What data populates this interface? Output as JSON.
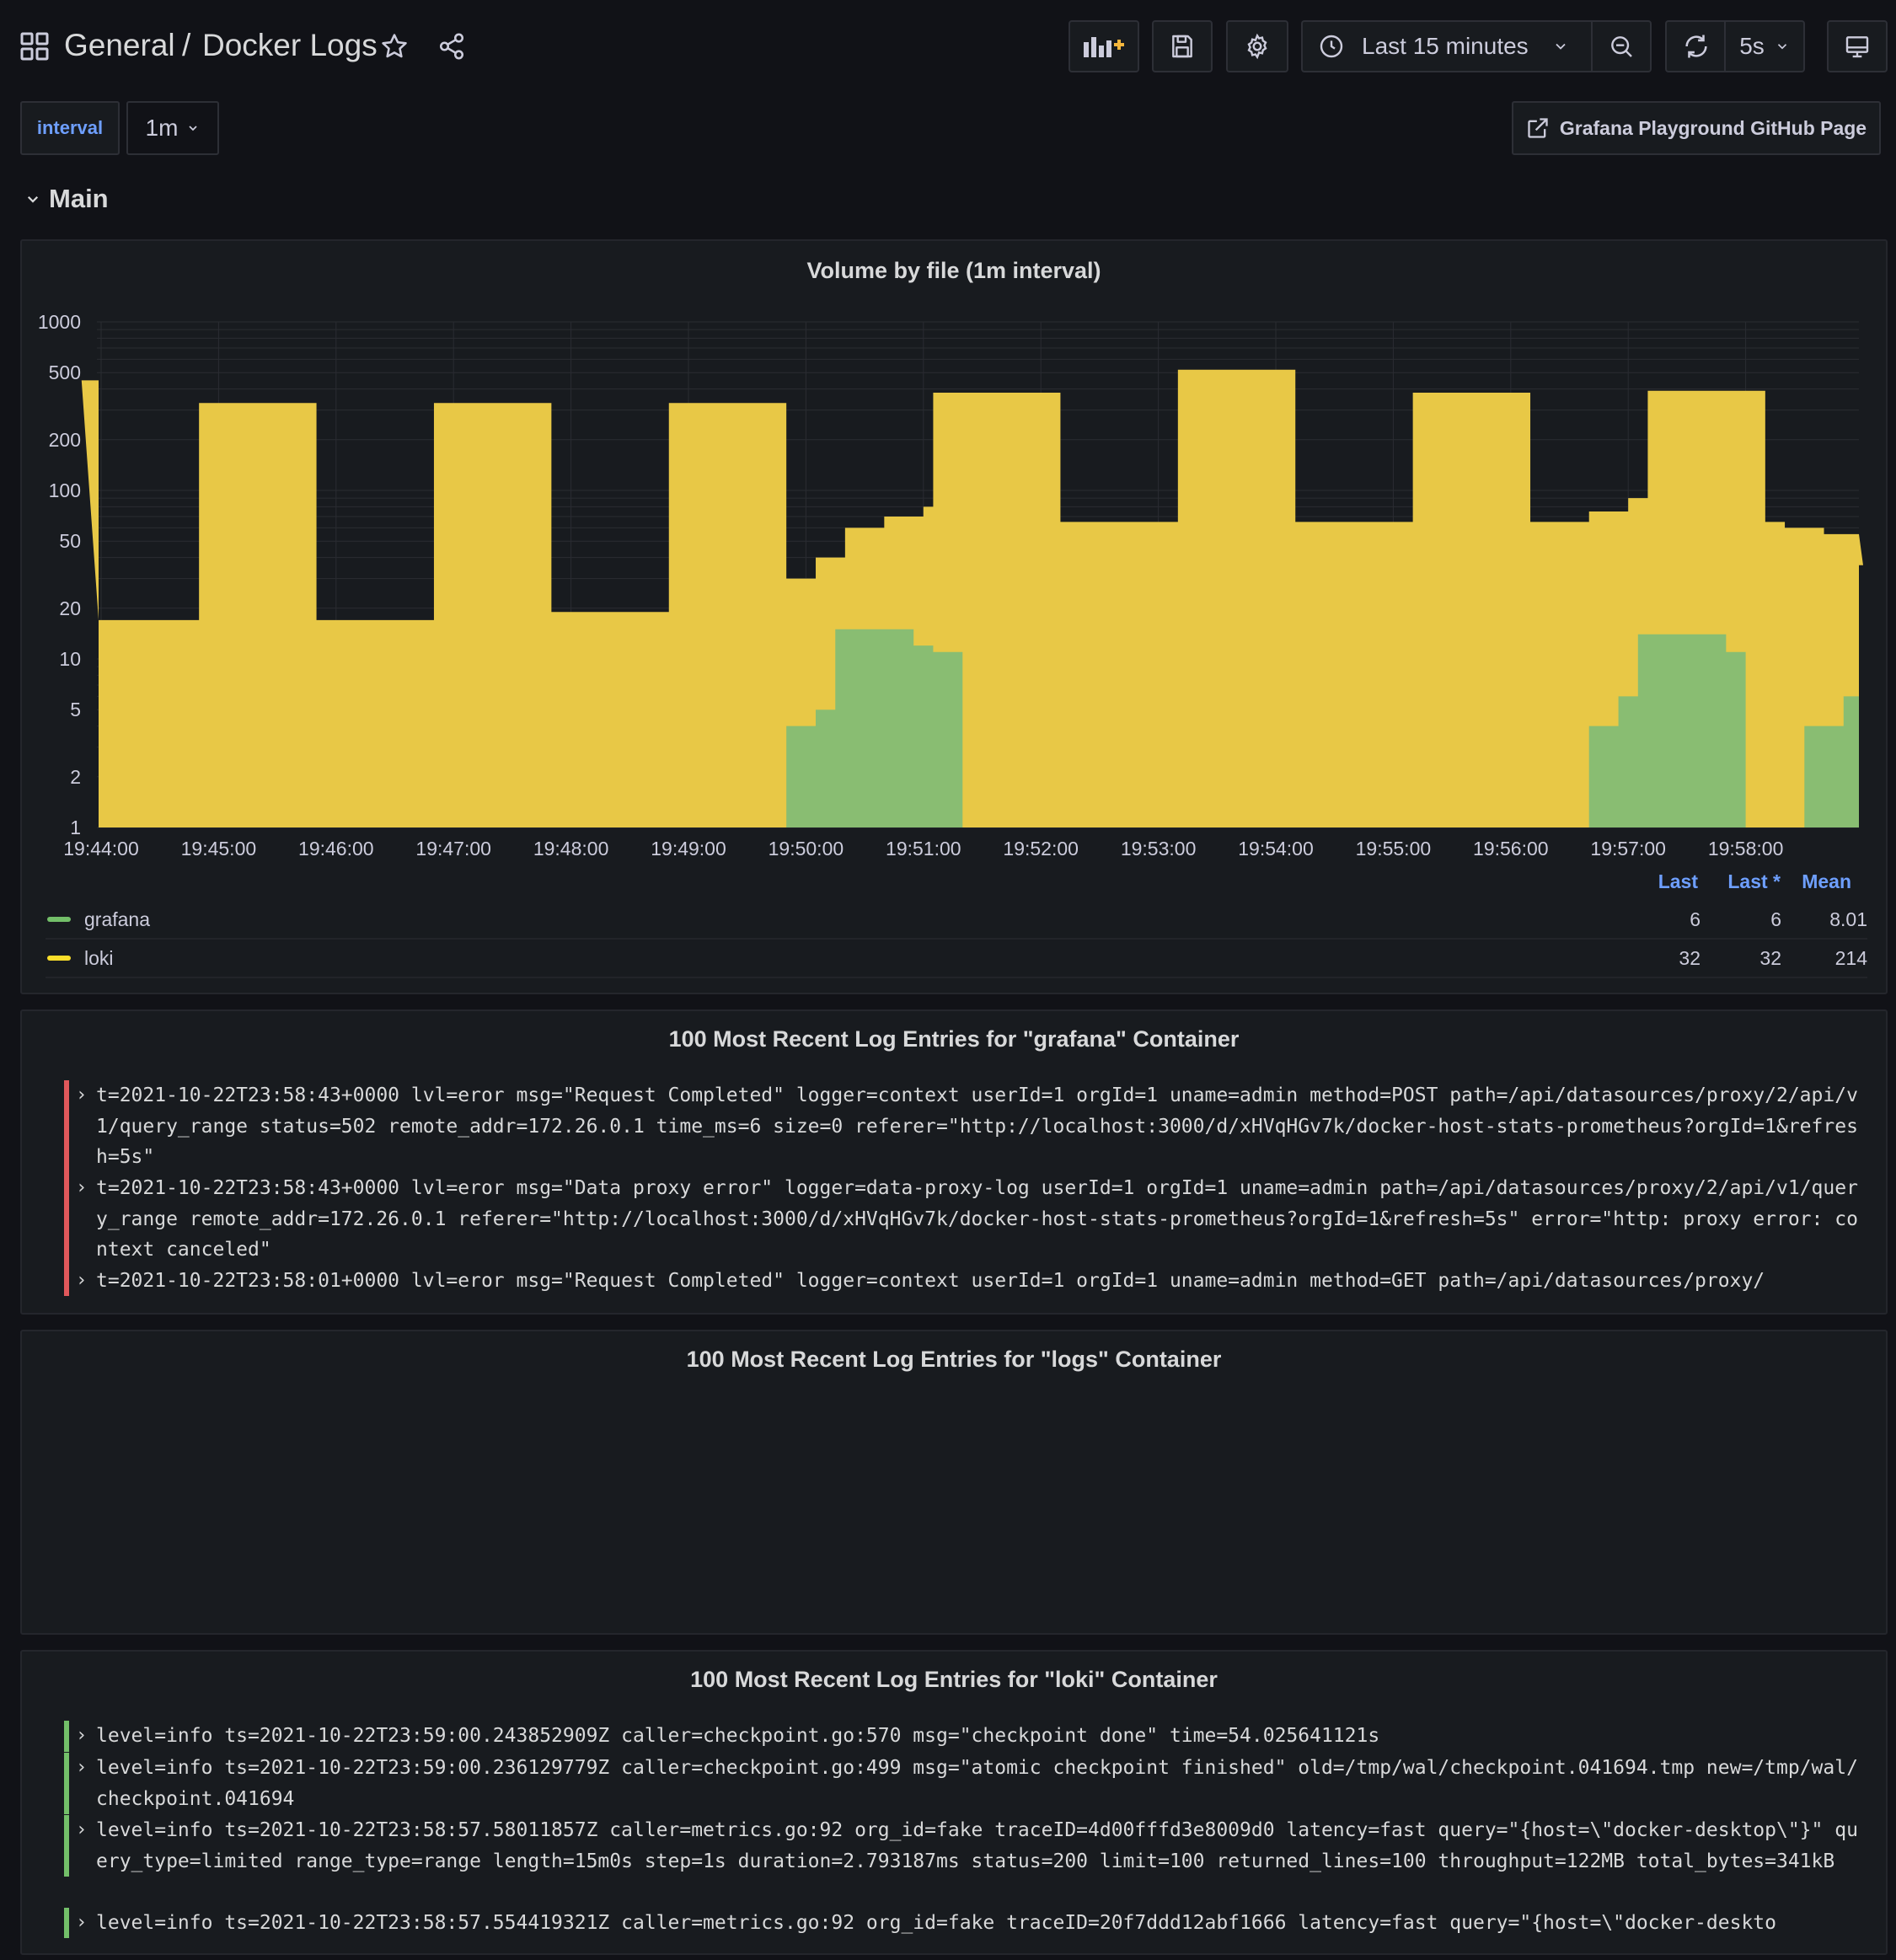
{
  "nav": {
    "breadcrumb_parent": "General",
    "breadcrumb_separator": "/",
    "dashboard_title": "Docker Logs",
    "time_range": "Last 15 minutes",
    "refresh_interval": "5s"
  },
  "variables": {
    "interval_label": "interval",
    "interval_value": "1m",
    "link_label": "Grafana Playground GitHub Page"
  },
  "row": {
    "title": "Main"
  },
  "volume_panel": {
    "title": "Volume by file (1m interval)",
    "legend": {
      "headers": [
        "Last",
        "Last *",
        "Mean"
      ],
      "items": [
        {
          "name": "grafana",
          "color": "#73bf69",
          "last": "6",
          "last_star": "6",
          "mean": "8.01"
        },
        {
          "name": "loki",
          "color": "#fade2a",
          "last": "32",
          "last_star": "32",
          "mean": "214"
        }
      ]
    }
  },
  "chart_data": {
    "type": "area",
    "title": "Volume by file (1m interval)",
    "y_scale": "log",
    "ylim": [
      1,
      1000
    ],
    "y_ticks": [
      "1",
      "2",
      "5",
      "10",
      "20",
      "50",
      "100",
      "200",
      "500",
      "1000"
    ],
    "x_ticks": [
      "19:44:00",
      "19:45:00",
      "19:46:00",
      "19:47:00",
      "19:48:00",
      "19:49:00",
      "19:50:00",
      "19:51:00",
      "19:52:00",
      "19:53:00",
      "19:54:00",
      "19:55:00",
      "19:56:00",
      "19:57:00",
      "19:58:00"
    ],
    "stacked": true,
    "series": [
      {
        "name": "loki",
        "color": "#e8c846",
        "x": [
          "19:43:40",
          "19:43:50",
          "19:44:50",
          "19:45:50",
          "19:46:50",
          "19:47:50",
          "19:48:50",
          "19:49:50",
          "19:50:05",
          "19:50:20",
          "19:50:40",
          "19:51:00",
          "19:51:05",
          "19:52:10",
          "19:53:10",
          "19:54:10",
          "19:55:10",
          "19:56:10",
          "19:56:40",
          "19:57:00",
          "19:57:10",
          "19:58:10",
          "19:58:20",
          "19:58:40",
          "19:59:00"
        ],
        "values": [
          450,
          17,
          330,
          17,
          330,
          19,
          330,
          30,
          40,
          60,
          70,
          80,
          380,
          65,
          520,
          65,
          380,
          65,
          75,
          90,
          390,
          65,
          60,
          55,
          36
        ]
      },
      {
        "name": "grafana",
        "color": "#89bd72",
        "x": [
          "19:49:50",
          "19:50:05",
          "19:50:15",
          "19:50:25",
          "19:50:55",
          "19:51:05",
          "19:51:20",
          "19:51:25",
          "19:56:40",
          "19:56:55",
          "19:57:05",
          "19:57:50",
          "19:58:00",
          "19:58:30",
          "19:58:50"
        ],
        "values": [
          4,
          5,
          15,
          15,
          12,
          11,
          0,
          0,
          4,
          6,
          14,
          11,
          0,
          4,
          6
        ]
      }
    ],
    "legend": [
      "grafana",
      "loki"
    ]
  },
  "grafana_logs": {
    "title": "100 Most Recent Log Entries for \"grafana\" Container",
    "level_color": "#e0585b",
    "entries": [
      "t=2021-10-22T23:58:43+0000 lvl=eror msg=\"Request Completed\" logger=context userId=1 orgId=1 uname=admin method=POST path=/api/datasources/proxy/2/api/v1/query_range status=502 remote_addr=172.26.0.1 time_ms=6 size=0 referer=\"http://localhost:3000/d/xHVqHGv7k/docker-host-stats-prometheus?orgId=1&refresh=5s\"",
      "t=2021-10-22T23:58:43+0000 lvl=eror msg=\"Data proxy error\" logger=data-proxy-log userId=1 orgId=1 uname=admin path=/api/datasources/proxy/2/api/v1/query_range remote_addr=172.26.0.1 referer=\"http://localhost:3000/d/xHVqHGv7k/docker-host-stats-prometheus?orgId=1&refresh=5s\" error=\"http: proxy error: context canceled\"",
      "t=2021-10-22T23:58:01+0000 lvl=eror msg=\"Request Completed\" logger=context userId=1 orgId=1 uname=admin method=GET path=/api/datasources/proxy/"
    ]
  },
  "logs_logs": {
    "title": "100 Most Recent Log Entries for \"logs\" Container"
  },
  "loki_logs": {
    "title": "100 Most Recent Log Entries for \"loki\" Container",
    "level_color": "#73bf69",
    "entries": [
      "level=info ts=2021-10-22T23:59:00.243852909Z caller=checkpoint.go:570 msg=\"checkpoint done\" time=54.025641121s",
      "level=info ts=2021-10-22T23:59:00.236129779Z caller=checkpoint.go:499 msg=\"atomic checkpoint finished\" old=/tmp/wal/checkpoint.041694.tmp new=/tmp/wal/checkpoint.041694",
      "level=info ts=2021-10-22T23:58:57.58011857Z caller=metrics.go:92 org_id=fake traceID=4d00fffd3e8009d0 latency=fast query=\"{host=\\\"docker-desktop\\\"}\" query_type=limited range_type=range length=15m0s step=1s duration=2.793187ms status=200 limit=100 returned_lines=100 throughput=122MB total_bytes=341kB",
      "level=info ts=2021-10-22T23:58:57.554419321Z caller=metrics.go:92 org_id=fake traceID=20f7ddd12abf1666 latency=fast query=\"{host=\\\"docker-deskto"
    ]
  }
}
